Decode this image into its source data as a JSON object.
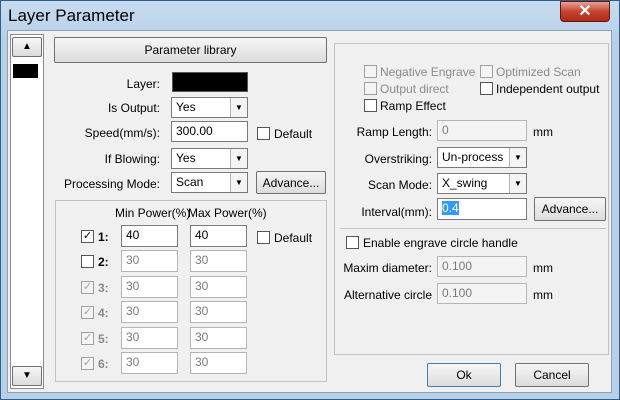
{
  "window": {
    "title": "Layer Parameter",
    "close_glyph": "✕"
  },
  "layer_list": {
    "up_glyph": "▲",
    "down_glyph": "▼",
    "selected_color": "#000000"
  },
  "left": {
    "param_library_button": "Parameter library",
    "layer_label": "Layer:",
    "layer_color": "#000000",
    "is_output_label": "Is Output:",
    "is_output_value": "Yes",
    "speed_label": "Speed(mm/s):",
    "speed_value": "300.00",
    "default_label": "Default",
    "if_blowing_label": "If Blowing:",
    "if_blowing_value": "Yes",
    "processing_mode_label": "Processing Mode:",
    "processing_mode_value": "Scan",
    "advance_button": "Advance..."
  },
  "power": {
    "min_header": "Min Power(%)",
    "max_header": "Max Power(%)",
    "default_label": "Default",
    "rows": [
      {
        "label": "1:",
        "checked": true,
        "enabled": true,
        "min": "40",
        "max": "40"
      },
      {
        "label": "2:",
        "checked": false,
        "enabled": true,
        "min": "30",
        "max": "30"
      },
      {
        "label": "3:",
        "checked": true,
        "enabled": false,
        "min": "30",
        "max": "30"
      },
      {
        "label": "4:",
        "checked": true,
        "enabled": false,
        "min": "30",
        "max": "30"
      },
      {
        "label": "5:",
        "checked": true,
        "enabled": false,
        "min": "30",
        "max": "30"
      },
      {
        "label": "6:",
        "checked": true,
        "enabled": false,
        "min": "30",
        "max": "30"
      }
    ]
  },
  "right": {
    "negative_engrave": "Negative Engrave",
    "optimized_scan": "Optimized Scan",
    "output_direct": "Output direct",
    "independent_output": "Independent output",
    "ramp_effect": "Ramp Effect",
    "ramp_length_label": "Ramp Length:",
    "ramp_length_value": "0",
    "unit_mm": "mm",
    "overstriking_label": "Overstriking:",
    "overstriking_value": "Un-process",
    "scan_mode_label": "Scan Mode:",
    "scan_mode_value": "X_swing",
    "interval_label": "Interval(mm):",
    "interval_value": "0.4",
    "advance_button": "Advance...",
    "engrave_circle_label": "Enable engrave circle handle",
    "maxim_diameter_label": "Maxim diameter:",
    "maxim_diameter_value": "0.100",
    "alt_circle_label": "Alternative circle",
    "alt_circle_value": "0.100"
  },
  "footer": {
    "ok": "Ok",
    "cancel": "Cancel"
  },
  "colors": {
    "title_bar": "#b7cfe8",
    "close": "#c4432d",
    "selection": "#3399ff"
  }
}
